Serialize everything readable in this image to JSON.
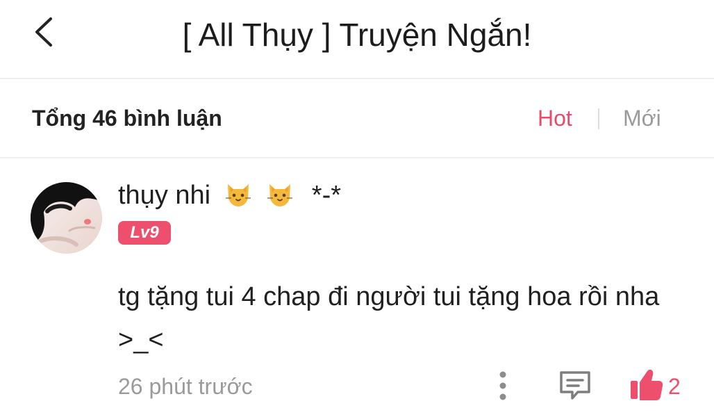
{
  "header": {
    "title": "[ All Thụy ] Truyện Ngắn!",
    "back_icon": "chevron-left-icon"
  },
  "summary": {
    "total_label": "Tổng 46 bình luận",
    "sort_hot": "Hot",
    "sort_new": "Mới",
    "active_sort": "Hot"
  },
  "comment": {
    "username": "thụy nhi",
    "username_emojis": [
      "cat-face-icon",
      "cat-face-icon"
    ],
    "username_suffix": "*-*",
    "level": "Lv9",
    "text": "tg tặng tui 4 chap đi người tui tặng hoa rồi nha >_<",
    "time": "26 phút trước",
    "likes": "2"
  },
  "colors": {
    "accent": "#ee4f6d",
    "hot_text": "#e44d6b",
    "muted_text": "#9a9a9a",
    "divider": "#ededed"
  }
}
